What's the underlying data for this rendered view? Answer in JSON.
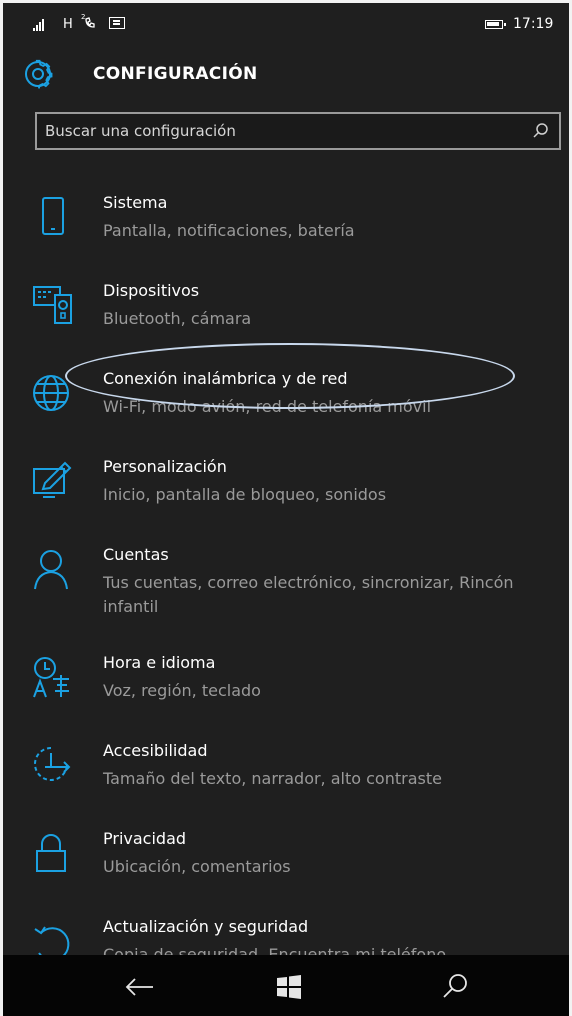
{
  "status_bar": {
    "network": "H",
    "time": "17:19"
  },
  "header": {
    "title": "CONFIGURACIÓN",
    "icon": "gear-icon"
  },
  "search": {
    "placeholder": "Buscar una configuración",
    "icon": "search-icon"
  },
  "settings": [
    {
      "label": "Sistema",
      "desc": "Pantalla, notificaciones, batería",
      "icon": "phone-icon"
    },
    {
      "label": "Dispositivos",
      "desc": "Bluetooth, cámara",
      "icon": "devices-icon"
    },
    {
      "label": "Conexión inalámbrica y de red",
      "desc": "Wi-Fi, modo avión, red de telefonía móvil",
      "icon": "globe-icon"
    },
    {
      "label": "Personalización",
      "desc": "Inicio, pantalla de bloqueo, sonidos",
      "icon": "paint-icon"
    },
    {
      "label": "Cuentas",
      "desc": "Tus cuentas, correo electrónico, sincronizar, Rincón infantil",
      "icon": "person-icon"
    },
    {
      "label": "Hora e idioma",
      "desc": "Voz, región, teclado",
      "icon": "time-language-icon"
    },
    {
      "label": "Accesibilidad",
      "desc": "Tamaño del texto, narrador, alto contraste",
      "icon": "accessibility-icon"
    },
    {
      "label": "Privacidad",
      "desc": "Ubicación, comentarios",
      "icon": "lock-icon"
    },
    {
      "label": "Actualización y seguridad",
      "desc": "Copia de seguridad, Encuentra mi teléfono",
      "icon": "update-icon"
    }
  ],
  "navbar": {
    "back_icon": "back-arrow-icon",
    "start_icon": "windows-icon",
    "search_icon": "search-icon"
  },
  "colors": {
    "accent": "#1ba1e2",
    "background": "#1f1f1f",
    "secondary_text": "#9a9a9a",
    "annotation": "#c8d8ec"
  }
}
